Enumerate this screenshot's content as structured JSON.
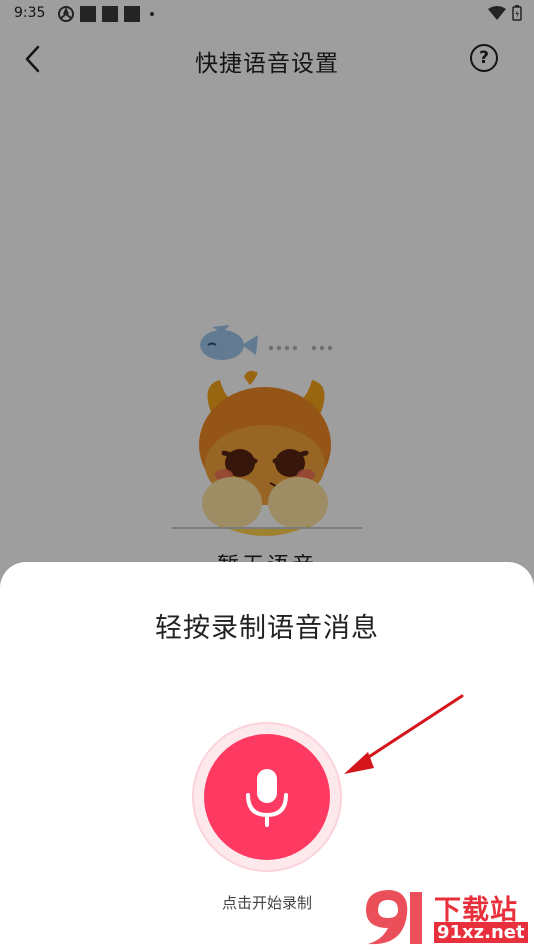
{
  "status_bar": {
    "time": "9:35"
  },
  "header": {
    "title": "快捷语音设置",
    "help_symbol": "?",
    "back_icon": "chevron-left-icon"
  },
  "mascot": {
    "caption": "暂无语音"
  },
  "sheet": {
    "title": "轻按录制语音消息",
    "record_hint": "点击开始录制",
    "accent_color": "#ff3a62"
  },
  "watermark": {
    "brand": "下载站",
    "domain": "91xz.net"
  }
}
